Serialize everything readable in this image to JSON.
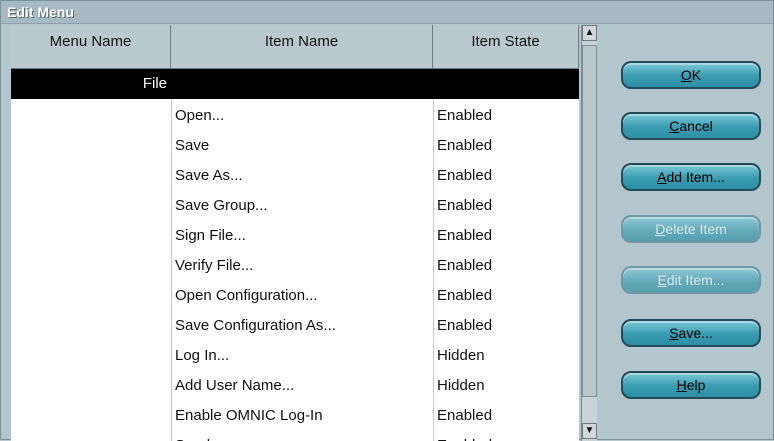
{
  "window": {
    "title": "Edit Menu"
  },
  "columns": [
    "Menu Name",
    "Item Name",
    "Item State"
  ],
  "rows": [
    {
      "menu": "File",
      "item": "",
      "state": "",
      "selected": true
    },
    {
      "menu": "",
      "item": "Open...",
      "state": "Enabled"
    },
    {
      "menu": "",
      "item": "Save",
      "state": "Enabled"
    },
    {
      "menu": "",
      "item": "Save As...",
      "state": "Enabled"
    },
    {
      "menu": "",
      "item": "Save Group...",
      "state": "Enabled"
    },
    {
      "menu": "",
      "item": "Sign File...",
      "state": "Enabled"
    },
    {
      "menu": "",
      "item": "Verify File...",
      "state": "Enabled"
    },
    {
      "menu": "",
      "item": "Open Configuration...",
      "state": "Enabled"
    },
    {
      "menu": "",
      "item": "Save Configuration As...",
      "state": "Enabled"
    },
    {
      "menu": "",
      "item": "Log In...",
      "state": "Hidden"
    },
    {
      "menu": "",
      "item": "Add User Name...",
      "state": "Hidden"
    },
    {
      "menu": "",
      "item": "Enable OMNIC Log-In",
      "state": "Enabled"
    },
    {
      "menu": "",
      "item": "Send...",
      "state": "Enabled"
    }
  ],
  "buttons": {
    "ok": {
      "mnemonic": "O",
      "rest": "K"
    },
    "cancel": {
      "mnemonic": "C",
      "rest": "ancel"
    },
    "add_item": {
      "mnemonic": "A",
      "rest": "dd Item..."
    },
    "delete_item": {
      "mnemonic": "D",
      "rest": "elete Item"
    },
    "edit_item": {
      "mnemonic": "E",
      "rest": "dit Item..."
    },
    "save": {
      "mnemonic": "S",
      "rest": "ave..."
    },
    "help": {
      "mnemonic": "H",
      "rest": "elp"
    }
  },
  "scrollbar": {
    "up_icon": "triangle-up",
    "down_icon": "triangle-down"
  }
}
